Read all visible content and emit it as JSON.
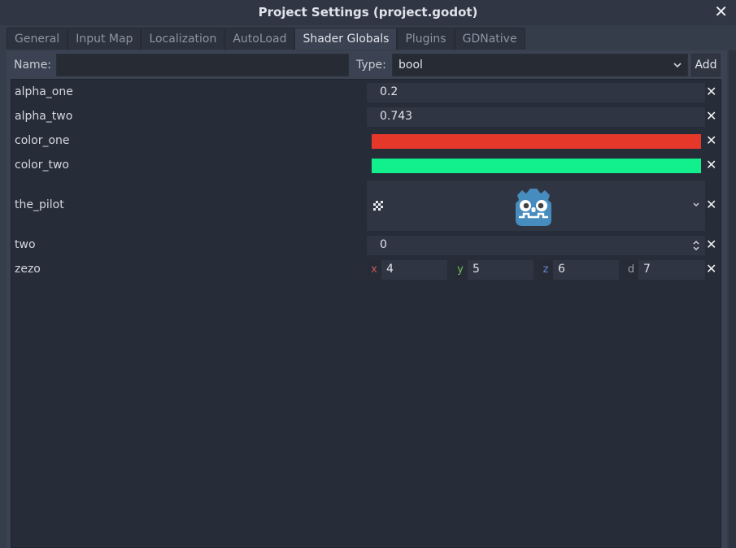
{
  "window": {
    "title": "Project Settings (project.godot)"
  },
  "tabs": [
    {
      "label": "General"
    },
    {
      "label": "Input Map"
    },
    {
      "label": "Localization"
    },
    {
      "label": "AutoLoad"
    },
    {
      "label": "Shader Globals"
    },
    {
      "label": "Plugins"
    },
    {
      "label": "GDNative"
    }
  ],
  "active_tab": "Shader Globals",
  "form": {
    "name_label": "Name:",
    "name_value": "",
    "type_label": "Type:",
    "type_value": "bool",
    "add_label": "Add"
  },
  "globals": {
    "alpha_one": {
      "name": "alpha_one",
      "value": "0.2"
    },
    "alpha_two": {
      "name": "alpha_two",
      "value": "0.743"
    },
    "color_one": {
      "name": "color_one",
      "color": "#e5372a"
    },
    "color_two": {
      "name": "color_two",
      "color": "#12f08e"
    },
    "the_pilot": {
      "name": "the_pilot",
      "icon": "godot-logo-icon"
    },
    "two": {
      "name": "two",
      "value": "0"
    },
    "zezo": {
      "name": "zezo",
      "x_axis": "x",
      "x": "4",
      "y_axis": "y",
      "y": "5",
      "z_axis": "z",
      "z": "6",
      "d_axis": "d",
      "d": "7"
    }
  },
  "colors": {
    "axis_x": "#c75c5c",
    "axis_y": "#6fc25c",
    "axis_z": "#6a86d8",
    "axis_d": "#9aa0aa"
  }
}
